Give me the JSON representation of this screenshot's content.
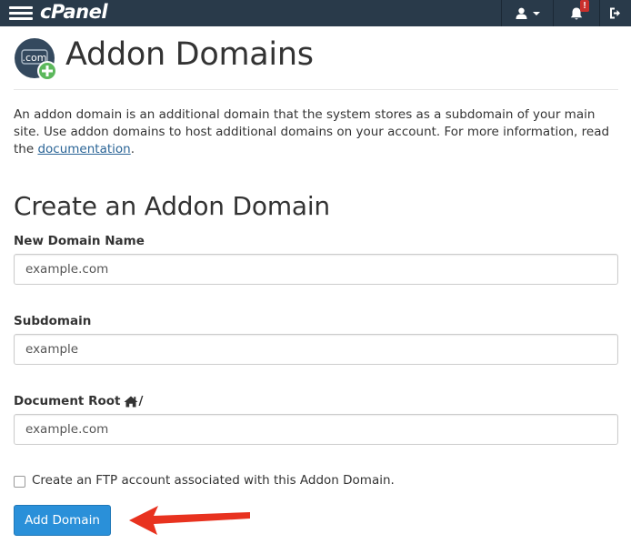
{
  "app": {
    "logo_text": "cPanel"
  },
  "navbar": {
    "notification_badge": "!",
    "icons": [
      "menu-icon",
      "user-icon",
      "bell-icon",
      "logout-icon"
    ]
  },
  "page": {
    "title": "Addon Domains",
    "icon_label": ".com",
    "intro_text": "An addon domain is an additional domain that the system stores as a subdomain of your main site. Use addon domains to host additional domains on your account. For more information, read the ",
    "intro_link": "documentation",
    "intro_end": "."
  },
  "form": {
    "title": "Create an Addon Domain",
    "new_domain_label": "New Domain Name",
    "new_domain_placeholder": "example.com",
    "subdomain_label": "Subdomain",
    "subdomain_placeholder": "example",
    "docroot_label": "Document Root",
    "docroot_suffix": "/",
    "docroot_placeholder": "example.com",
    "ftp_checkbox_label": "Create an FTP account associated with this Addon Domain.",
    "submit_label": "Add Domain"
  },
  "colors": {
    "navbar": "#293a4a",
    "primary_button": "#2a90d9",
    "link": "#2a6496",
    "icon_circle": "#34495e",
    "icon_plus": "#5cb85c",
    "annotation_arrow": "#e8321f"
  }
}
